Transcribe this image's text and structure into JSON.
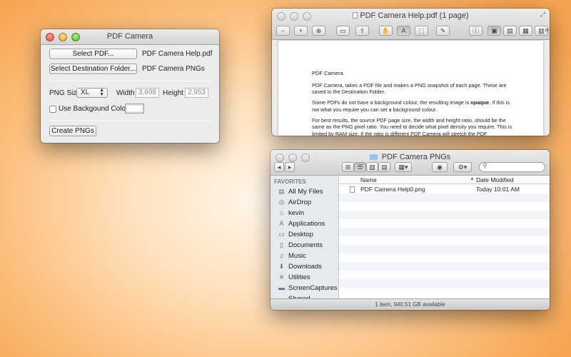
{
  "pdf_camera": {
    "title": "PDF Camera",
    "select_pdf_button": "Select PDF...",
    "selected_pdf": "PDF Camera Help.pdf",
    "select_dest_button": "Select Destination Folder...",
    "selected_dest": "PDF Camera PNGs",
    "png_size_label": "PNG Size",
    "png_size_value": "XL",
    "width_label": "Width",
    "width_value": "3,898",
    "height_label": "Height",
    "height_value": "2,953",
    "bg_colour_label": "Use Backgound Colour",
    "bg_colour_checked": false,
    "bg_colour_value": "#ffffff",
    "create_button": "Create PNGs"
  },
  "preview": {
    "title": "PDF Camera Help.pdf (1 page)",
    "doc": {
      "heading": "PDF Camera",
      "p1": "PDF Camera, takes a PDF file and makes a PNG snapshot of each page. These are saved to the Destination Folder.",
      "p2_a": "Some PDFs do not have a background colour, the resulting image is ",
      "p2_bold": "opaque",
      "p2_b": ". If this is not what you require you can set a background colour.",
      "p3": "For best results, the source PDF page size, the width and height ratio, should be the same as the PNG pixel ratio. You need to decide what pixel density you require. This is limited by RAM size. If the ratio is different PDF Camera will stretch the PDF"
    },
    "toolbar_icons": [
      "zoom-out-icon",
      "zoom-in-icon",
      "zoom-fit-icon",
      "sidebar-toggle-icon",
      "share-icon",
      "hand-tool-icon",
      "text-tool-icon",
      "select-tool-icon",
      "annotate-icon",
      "info-icon",
      "single-page-icon",
      "two-page-icon",
      "contact-sheet-icon",
      "continuous-icon",
      "overflow-icon"
    ]
  },
  "finder": {
    "title": "PDF Camera PNGs",
    "favorites_label": "FAVORITES",
    "sidebar_items": [
      {
        "label": "All My Files",
        "icon": "all-files-icon"
      },
      {
        "label": "AirDrop",
        "icon": "airdrop-icon"
      },
      {
        "label": "kevin",
        "icon": "home-icon"
      },
      {
        "label": "Applications",
        "icon": "applications-icon"
      },
      {
        "label": "Desktop",
        "icon": "desktop-icon"
      },
      {
        "label": "Documents",
        "icon": "documents-icon"
      },
      {
        "label": "Music",
        "icon": "music-icon"
      },
      {
        "label": "Downloads",
        "icon": "downloads-icon"
      },
      {
        "label": "Utilities",
        "icon": "utilities-icon"
      },
      {
        "label": "ScreenCaptures",
        "icon": "folder-icon"
      },
      {
        "label": "Shared",
        "icon": "folder-icon"
      }
    ],
    "columns": {
      "name": "Name",
      "date": "Date Modified"
    },
    "files": [
      {
        "name": "PDF Camera Help0.png",
        "date": "Today 10:01 AM"
      }
    ],
    "status": "1 item, 940.51 GB available"
  }
}
